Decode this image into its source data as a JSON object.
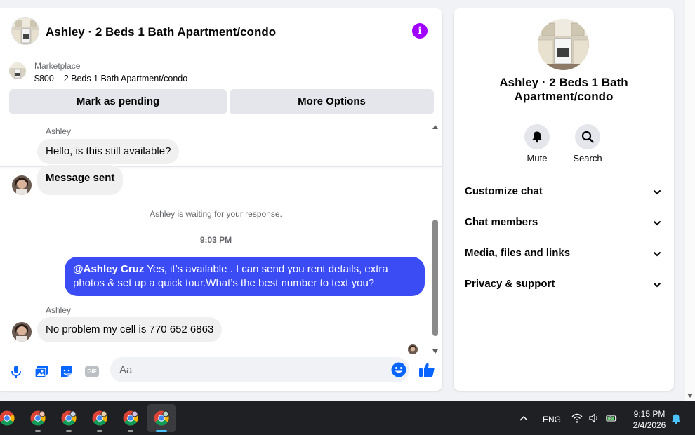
{
  "chat_header": {
    "title": "Ashley · 2 Beds 1 Bath Apartment/condo"
  },
  "listing": {
    "source": "Marketplace",
    "price_title": "$800 – 2 Beds 1 Bath Apartment/condo",
    "mark_pending_label": "Mark as pending",
    "more_options_label": "More Options"
  },
  "messages": {
    "sender_name_top": "Ashley",
    "incoming_1": "Hello, is this still available?",
    "incoming_2": "Message sent",
    "waiting_note": "Ashley is waiting for your response.",
    "timestamp": "9:03 PM",
    "outgoing_mention": "@Ashley Cruz",
    "outgoing_text": " Yes, it’s available .  I can send you rent details, extra photos & set up a quick tour.What’s the best number to text you?",
    "sender_name_bottom": "Ashley",
    "incoming_3": "No problem my cell is 770 652 6863"
  },
  "composer": {
    "placeholder": "Aa",
    "gif_label": "GIF"
  },
  "info_panel": {
    "title": "Ashley · 2 Beds 1 Bath Apartment/condo",
    "mute_label": "Mute",
    "search_label": "Search",
    "sections": [
      "Customize chat",
      "Chat members",
      "Media, files and links",
      "Privacy & support"
    ]
  },
  "taskbar": {
    "language": "ENG",
    "time": "9:15 PM",
    "date": "2/4/2026"
  },
  "colors": {
    "accent_blue": "#3b4cf5",
    "info_purple": "#a100ff",
    "messenger_blue": "#0866ff"
  }
}
